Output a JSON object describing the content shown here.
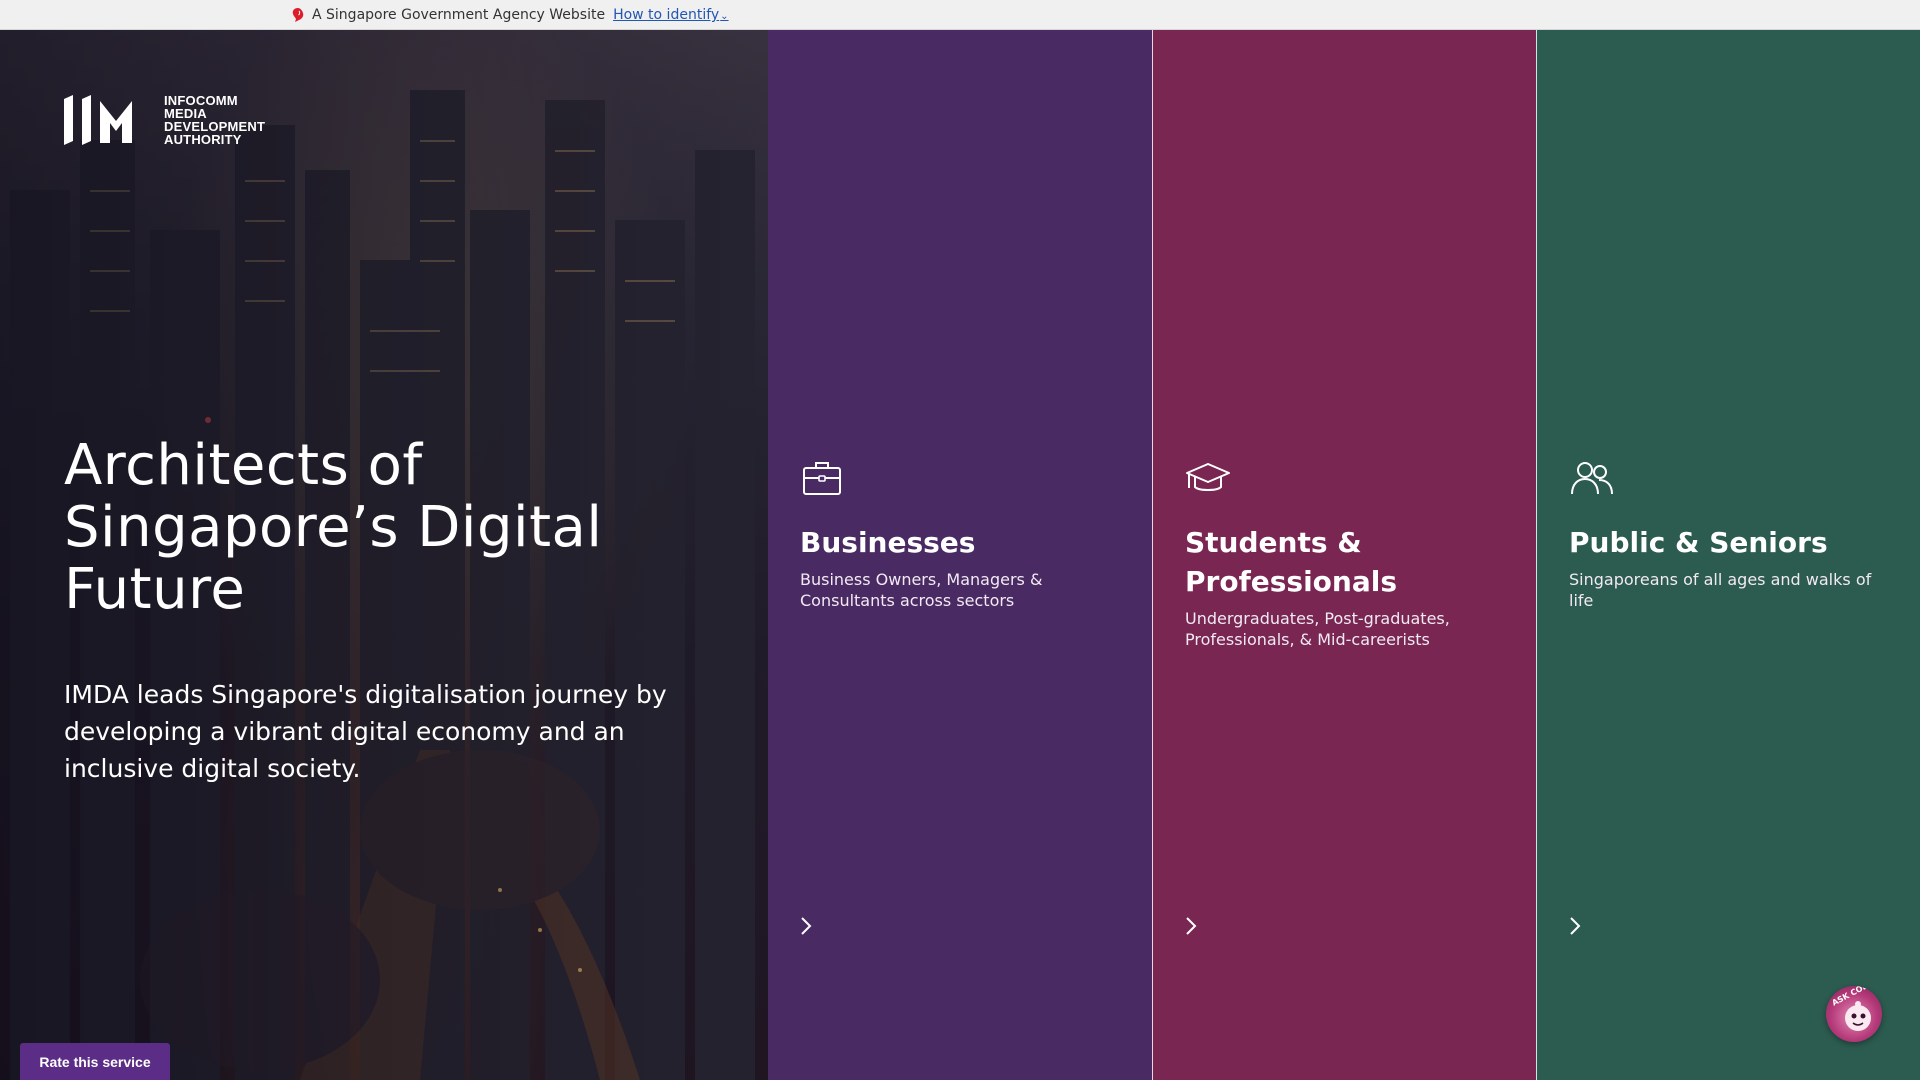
{
  "masthead": {
    "text": "A Singapore Government Agency Website",
    "link": "How to identify",
    "icon": "lion-head-icon"
  },
  "hero": {
    "logo": {
      "lines": [
        "INFOCOMM",
        "MEDIA",
        "DEVELOPMENT",
        "AUTHORITY"
      ]
    },
    "title": "Architects of Singapore’s Digital Future",
    "subtitle": "IMDA leads Singapore's digitalisation journey by developing a vibrant digital economy and an inclusive digital society."
  },
  "audiences": [
    {
      "title": "Businesses",
      "description": "Business Owners, Managers & Consultants across sectors",
      "icon": "briefcase-icon",
      "color": "#4a2a63"
    },
    {
      "title": "Students & Professionals",
      "description": "Undergraduates, Post-graduates, Professionals, & Mid-careerists",
      "icon": "graduation-cap-icon",
      "color": "#7a2652"
    },
    {
      "title": "Public & Seniors",
      "description": "Singaporeans of all ages and walks of life",
      "icon": "people-icon",
      "color": "#2c5b4f"
    }
  ],
  "rate_button": "Rate this service",
  "chatbot": {
    "label": "ASK CODI",
    "icon": "chatbot-avatar-icon"
  }
}
